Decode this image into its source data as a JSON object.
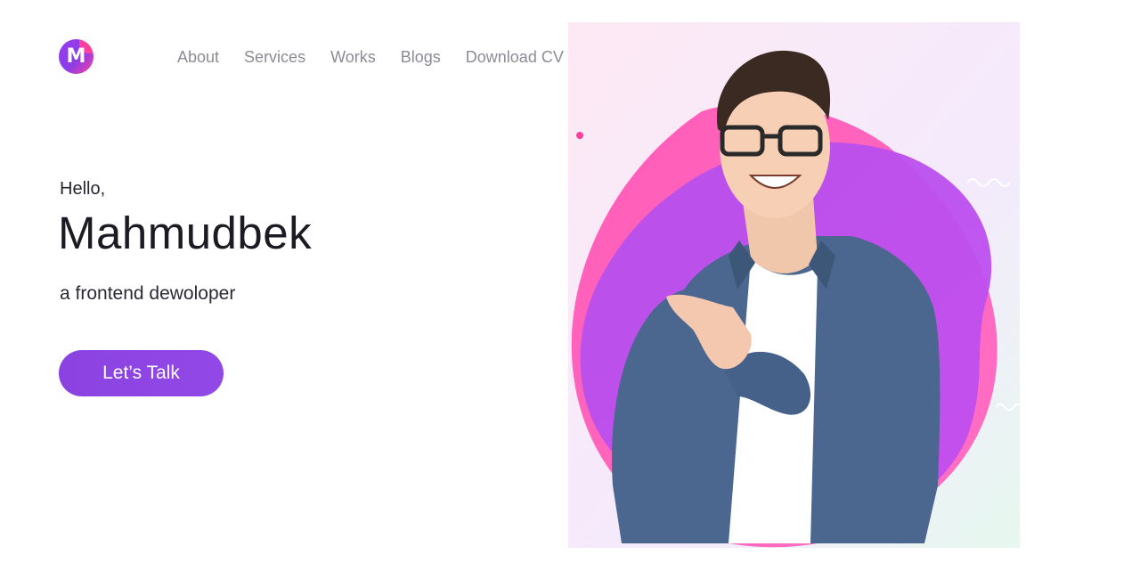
{
  "header": {
    "logo_letter": "M",
    "nav": [
      "About",
      "Services",
      "Works",
      "Blogs",
      "Download CV"
    ]
  },
  "hero": {
    "greeting": "Hello,",
    "name": "Mahmudbek",
    "role": "a frontend dewoloper",
    "cta_label": "Let’s Talk"
  },
  "colors": {
    "accent": "#8a42e0",
    "pink": "#ff4fb0",
    "purple": "#b44ae8",
    "nav_text": "#8e8a96"
  },
  "icons": {
    "logo": "m-logo-icon"
  }
}
